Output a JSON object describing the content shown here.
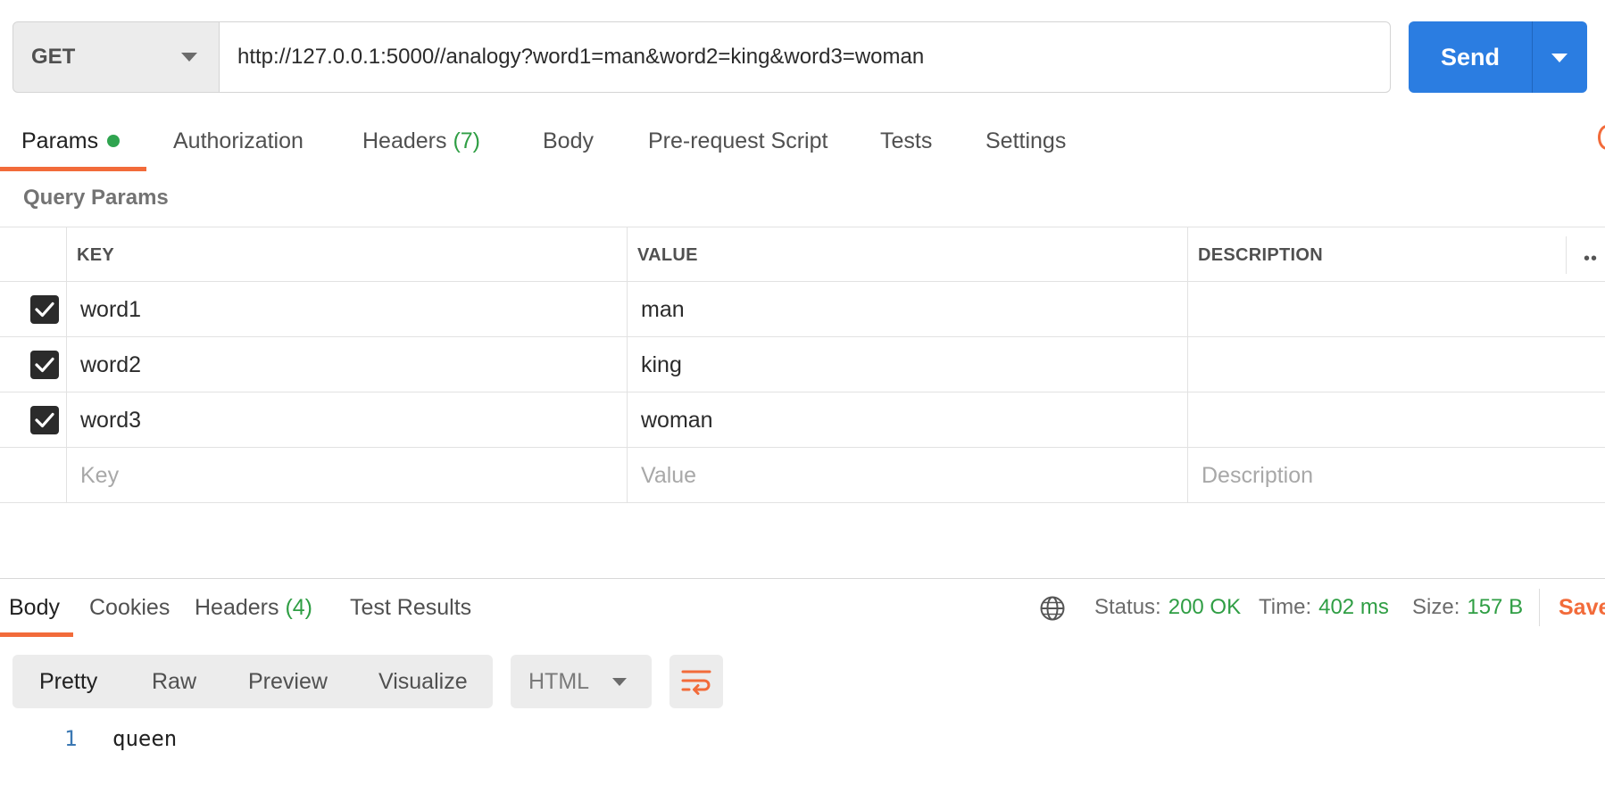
{
  "request": {
    "method": "GET",
    "url": "http://127.0.0.1:5000//analogy?word1=man&word2=king&word3=woman",
    "send_label": "Send"
  },
  "request_tabs": [
    {
      "label": "Params",
      "active": true,
      "indicator": true
    },
    {
      "label": "Authorization"
    },
    {
      "label": "Headers",
      "count": "(7)"
    },
    {
      "label": "Body"
    },
    {
      "label": "Pre-request Script"
    },
    {
      "label": "Tests"
    },
    {
      "label": "Settings"
    }
  ],
  "query_params": {
    "title": "Query Params",
    "columns": {
      "key": "KEY",
      "value": "VALUE",
      "description": "DESCRIPTION"
    },
    "more_label": "••",
    "rows": [
      {
        "checked": true,
        "key": "word1",
        "value": "man",
        "description": ""
      },
      {
        "checked": true,
        "key": "word2",
        "value": "king",
        "description": ""
      },
      {
        "checked": true,
        "key": "word3",
        "value": "woman",
        "description": ""
      }
    ],
    "placeholders": {
      "key": "Key",
      "value": "Value",
      "description": "Description"
    }
  },
  "response_tabs": [
    {
      "label": "Body",
      "active": true
    },
    {
      "label": "Cookies"
    },
    {
      "label": "Headers",
      "count": "(4)"
    },
    {
      "label": "Test Results"
    }
  ],
  "response_meta": {
    "status_label": "Status:",
    "status_value": "200 OK",
    "time_label": "Time:",
    "time_value": "402 ms",
    "size_label": "Size:",
    "size_value": "157 B",
    "save_label": "Save"
  },
  "format_options": [
    {
      "label": "Pretty",
      "active": true
    },
    {
      "label": "Raw"
    },
    {
      "label": "Preview"
    },
    {
      "label": "Visualize"
    }
  ],
  "language": "HTML",
  "body_lines": [
    {
      "number": "1",
      "text": "queen"
    }
  ],
  "colors": {
    "accent": "#f26b3a",
    "send": "#2b7de1",
    "success": "#2f9e44"
  }
}
